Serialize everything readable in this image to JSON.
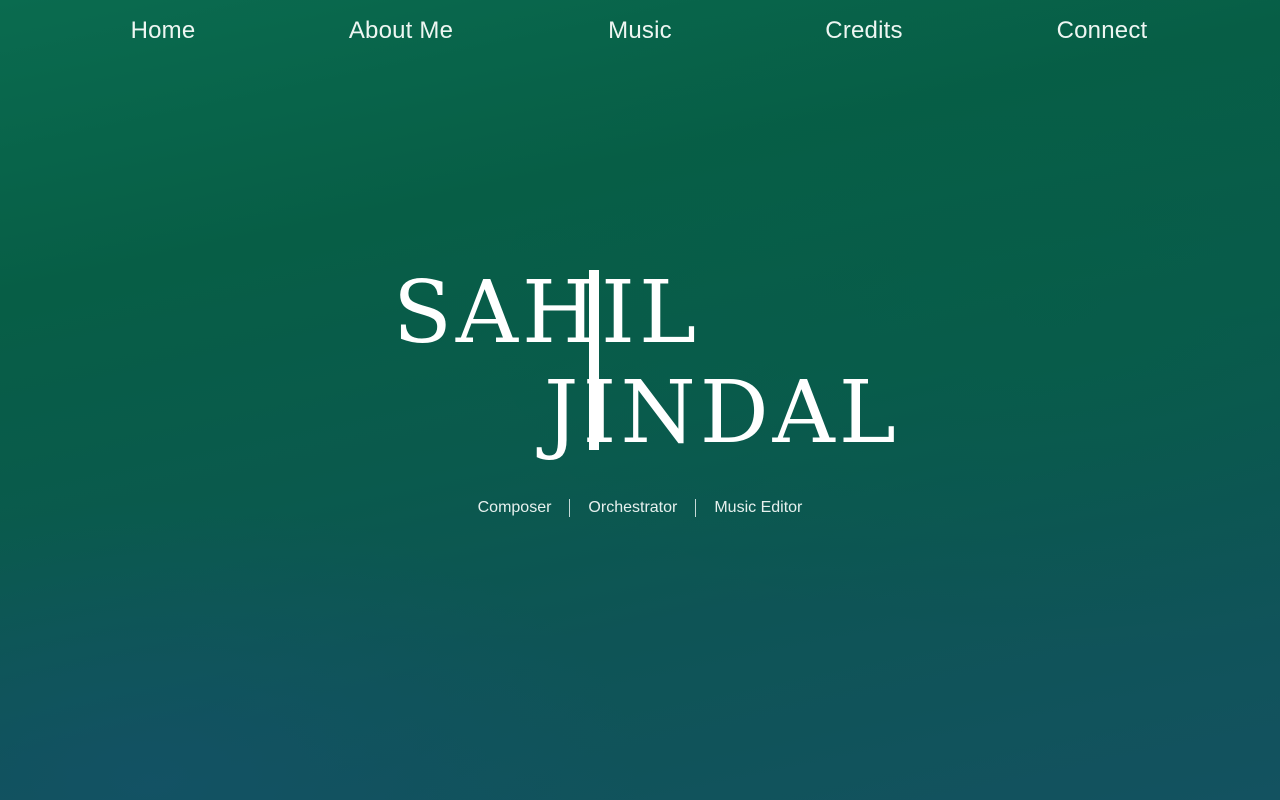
{
  "nav": {
    "items": [
      {
        "label": "Home"
      },
      {
        "label": "About Me"
      },
      {
        "label": "Music"
      },
      {
        "label": "Credits"
      },
      {
        "label": "Connect"
      }
    ]
  },
  "logo": {
    "line1": "SAHIL",
    "line2": "JINDAL"
  },
  "roles": [
    "Composer",
    "Orchestrator",
    "Music Editor"
  ],
  "colors": {
    "background_top": "#0a6b4f",
    "background_bottom": "#135260",
    "text": "#ffffff"
  }
}
